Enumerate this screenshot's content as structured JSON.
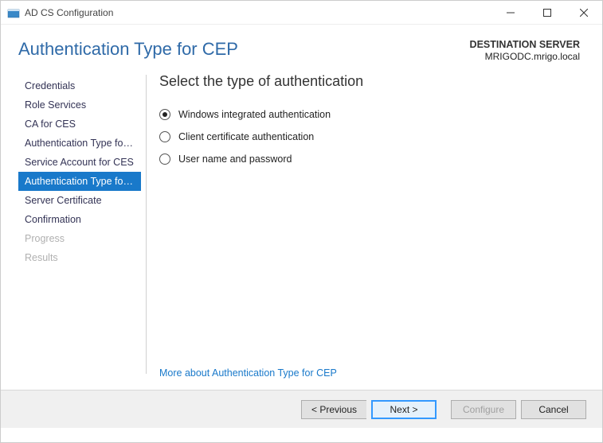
{
  "window": {
    "title": "AD CS Configuration"
  },
  "header": {
    "page_title": "Authentication Type for CEP",
    "destination_label": "DESTINATION SERVER",
    "destination_server": "MRIGODC.mrigo.local"
  },
  "sidebar": {
    "steps": [
      {
        "label": "Credentials",
        "state": "normal"
      },
      {
        "label": "Role Services",
        "state": "normal"
      },
      {
        "label": "CA for CES",
        "state": "normal"
      },
      {
        "label": "Authentication Type for C...",
        "state": "normal"
      },
      {
        "label": "Service Account for CES",
        "state": "normal"
      },
      {
        "label": "Authentication Type for C...",
        "state": "active"
      },
      {
        "label": "Server Certificate",
        "state": "normal"
      },
      {
        "label": "Confirmation",
        "state": "normal"
      },
      {
        "label": "Progress",
        "state": "disabled"
      },
      {
        "label": "Results",
        "state": "disabled"
      }
    ]
  },
  "content": {
    "heading": "Select the type of authentication",
    "options": [
      {
        "label": "Windows integrated authentication",
        "selected": true
      },
      {
        "label": "Client certificate authentication",
        "selected": false
      },
      {
        "label": "User name and password",
        "selected": false
      }
    ],
    "learn_more": "More about Authentication Type for CEP"
  },
  "footer": {
    "previous": "< Previous",
    "next": "Next >",
    "configure": "Configure",
    "cancel": "Cancel"
  }
}
